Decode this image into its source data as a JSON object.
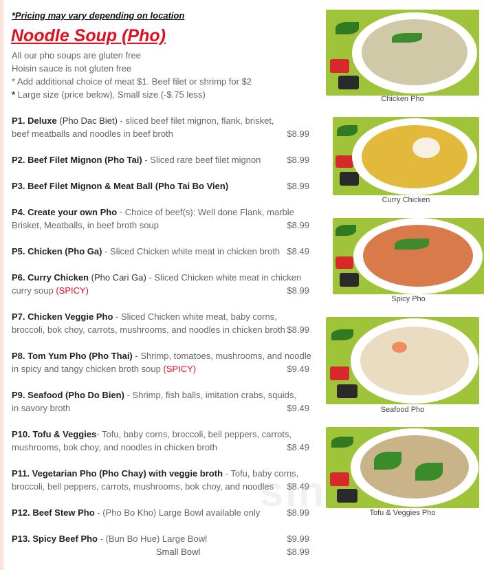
{
  "notice": "*Pricing may vary depending on location",
  "section_title": "Noodle Soup (Pho)",
  "notes": [
    {
      "star": "",
      "text": "All our pho soups are gluten free"
    },
    {
      "star": "",
      "text": "Hoisin sauce is not gluten free"
    },
    {
      "star": "",
      "text": "* Add additional choice of meat $1. Beef filet or shrimp for $2"
    },
    {
      "star": "*",
      "text": " Large size (price below), Small size (-$.75 less)"
    }
  ],
  "items": [
    {
      "code": "P1. Deluxe",
      "alt": " (Pho Dac Biet)",
      "desc1": " - sliced beef filet mignon, flank, brisket,",
      "desc2": "beef meatballs and noodles in beef broth",
      "price": "$8.99"
    },
    {
      "code": "P2. Beef Filet Mignon (Pho Tai)",
      "desc1": " - Sliced rare beef  filet mignon",
      "price": "$8.99"
    },
    {
      "code": "P3. Beef Filet Mignon & Meat Ball (Pho Tai Bo Vien)",
      "price": "$8.99"
    },
    {
      "code": "P4. Create your own Pho",
      "desc1": " - Choice of beef(s): Well done Flank, marble",
      "desc2": "Brisket, Meatballs, in beef broth soup",
      "price": "$8.99"
    },
    {
      "code": "P5. Chicken (Pho Ga)",
      "desc1": " - Sliced Chicken white meat in chicken broth",
      "price": "$8.49"
    },
    {
      "code": "P6. Curry Chicken",
      "alt": " (Pho Cari Ga)",
      "desc1": " - Sliced Chicken white meat in chicken",
      "desc2": "curry soup ",
      "spicy": "(SPICY)",
      "price": "$8.99"
    },
    {
      "code": "P7. Chicken Veggie Pho",
      "desc1": " - Sliced Chicken white meat, baby corns,",
      "desc2": "broccoli, bok choy, carrots, mushrooms, and noodles in chicken broth",
      "price": "$8.99"
    },
    {
      "code": "P8. Tom Yum Pho (Pho Thai)",
      "desc1": " - Shrimp, tomatoes, mushrooms, and noodle",
      "desc2": "in spicy and tangy chicken broth soup ",
      "spicy": "(SPICY)",
      "price": "$9.49"
    },
    {
      "code": "P9. Seafood  (Pho Do Bien)",
      "desc1": " - Shrimp, fish balls, imitation crabs, squids,",
      "desc2": "in savory broth",
      "price": "$9.49"
    },
    {
      "code": "P10. Tofu & Veggies",
      "desc1": "- Tofu, baby corns, broccoli, bell peppers, carrots,",
      "desc2": "mushrooms, bok choy, and noodles in chicken broth",
      "price": "$8.49"
    },
    {
      "code": "P11. Vegetarian Pho (Pho Chay) with veggie broth",
      "desc1": " - Tofu, baby corns,",
      "desc2": "broccoli, bell peppers, carrots, mushrooms, bok choy, and noodles",
      "price": "$8.49"
    },
    {
      "code": "P12.  Beef Stew Pho",
      "desc1": " - (Pho Bo Kho) Large Bowl available only",
      "price": "$8.99"
    },
    {
      "code": "P13.  Spicy Beef Pho",
      "desc1": " - (Bun Bo Hue) Large Bowl",
      "price": "$9.99",
      "sub_label": "Small Bowl",
      "sub_price": "$8.99"
    }
  ],
  "photos": [
    {
      "caption": "Chicken Pho",
      "broth": "#cfc9a8"
    },
    {
      "caption": "Curry Chicken",
      "broth": "#e2b93a"
    },
    {
      "caption": "Spicy Pho",
      "broth": "#d87a4a"
    },
    {
      "caption": "Seafood Pho",
      "broth": "#e9dcc0"
    },
    {
      "caption": "Tofu & Veggies Pho",
      "broth": "#c9b48a"
    }
  ],
  "colors": {
    "accent_red": "#e0101e",
    "photo_bg": "#9fc43a"
  },
  "watermark": "sin"
}
